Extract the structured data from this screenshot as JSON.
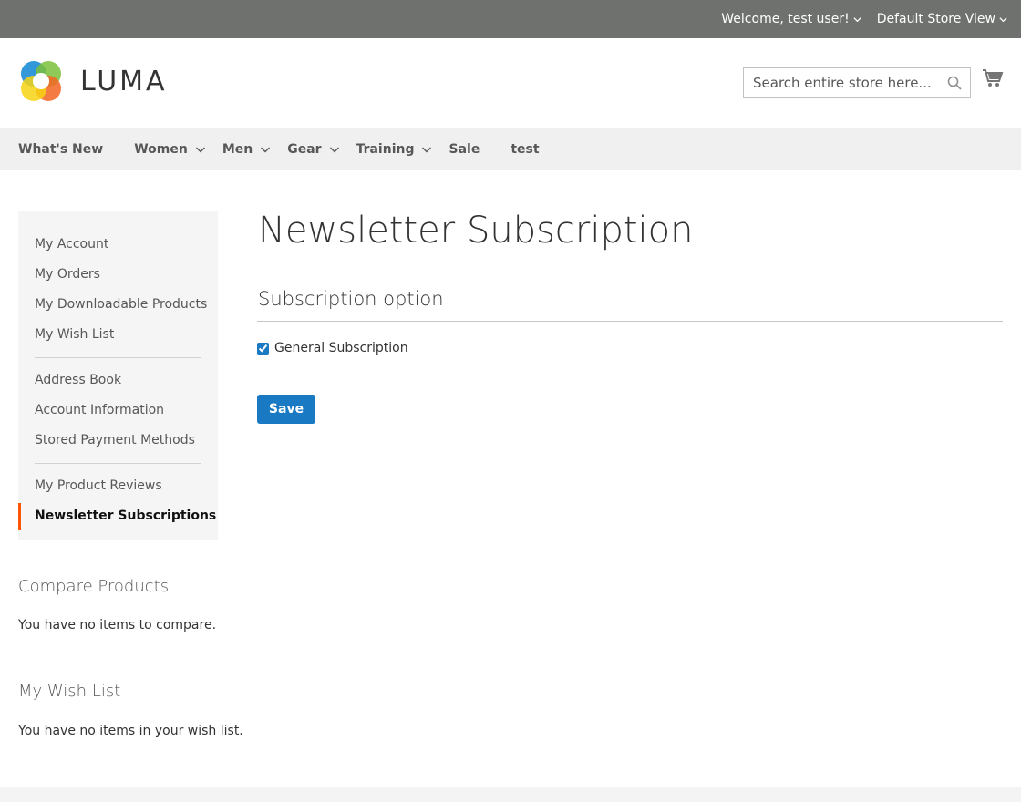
{
  "panel": {
    "welcome": "Welcome, test user!",
    "store_view": "Default Store View"
  },
  "header": {
    "logo_text": "LUMA",
    "search_placeholder": "Search entire store here...",
    "search_icon": "search-icon",
    "cart_icon": "cart-icon"
  },
  "nav": {
    "items": [
      {
        "label": "What's New"
      },
      {
        "label": "Women"
      },
      {
        "label": "Men"
      },
      {
        "label": "Gear"
      },
      {
        "label": "Training"
      },
      {
        "label": "Sale"
      },
      {
        "label": "test"
      }
    ]
  },
  "sidebar": {
    "items": [
      {
        "label": "My Account"
      },
      {
        "label": "My Orders"
      },
      {
        "label": "My Downloadable Products"
      },
      {
        "label": "My Wish List"
      },
      {
        "label": "Address Book"
      },
      {
        "label": "Account Information"
      },
      {
        "label": "Stored Payment Methods"
      },
      {
        "label": "My Product Reviews"
      },
      {
        "label": "Newsletter Subscriptions"
      }
    ]
  },
  "compare": {
    "title": "Compare Products",
    "text": "You have no items to compare."
  },
  "wishlist": {
    "title": "My Wish List",
    "text": "You have no items in your wish list."
  },
  "main": {
    "title": "Newsletter Subscription",
    "legend": "Subscription option",
    "checkbox_label": "General Subscription",
    "checkbox_checked": true,
    "save_label": "Save"
  },
  "colors": {
    "accent": "#1979c3",
    "active_marker": "#ff5501",
    "panel_bg": "#6e716e"
  }
}
